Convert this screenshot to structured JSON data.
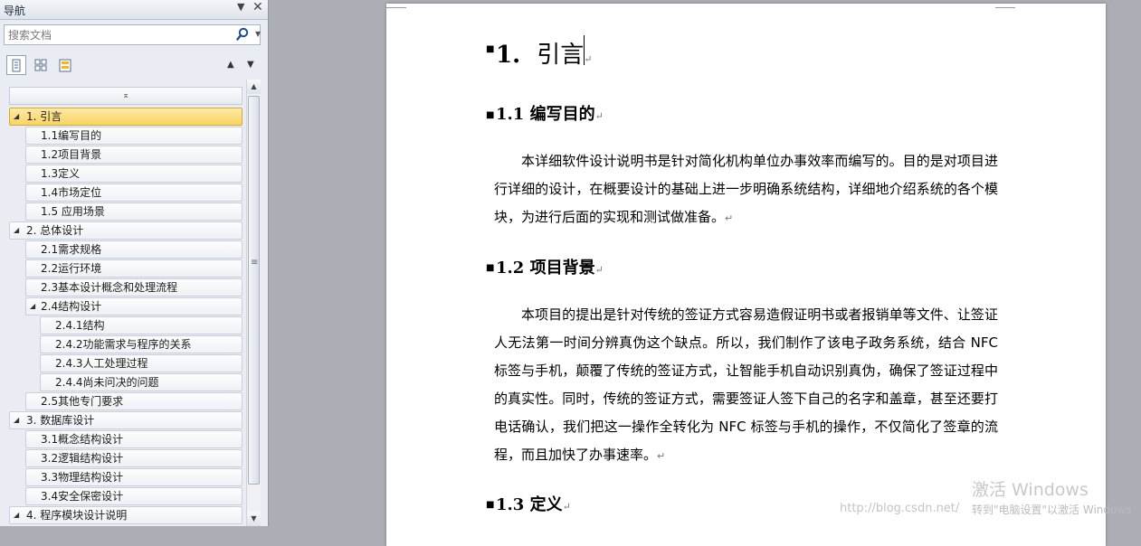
{
  "nav": {
    "title": "导航",
    "pin_glyph": "▼",
    "close_glyph": "✕",
    "search_placeholder": "搜索文档",
    "tabs": [
      "headings",
      "pages",
      "results"
    ],
    "tree": [
      {
        "label": "1. 引言",
        "level": 1,
        "expanded": true,
        "selected": true
      },
      {
        "label": "1.1编写目的",
        "level": 2
      },
      {
        "label": "1.2项目背景",
        "level": 2
      },
      {
        "label": "1.3定义",
        "level": 2
      },
      {
        "label": "1.4市场定位",
        "level": 2
      },
      {
        "label": "1.5 应用场景",
        "level": 2
      },
      {
        "label": "2. 总体设计",
        "level": 1,
        "expanded": true
      },
      {
        "label": "2.1需求规格",
        "level": 2
      },
      {
        "label": "2.2运行环境",
        "level": 2
      },
      {
        "label": "2.3基本设计概念和处理流程",
        "level": 2
      },
      {
        "label": "2.4结构设计",
        "level": 2,
        "expanded": true
      },
      {
        "label": "2.4.1结构",
        "level": 3
      },
      {
        "label": "2.4.2功能需求与程序的关系",
        "level": 3
      },
      {
        "label": "2.4.3人工处理过程",
        "level": 3
      },
      {
        "label": "2.4.4尚未问决的问题",
        "level": 3
      },
      {
        "label": "2.5其他专门要求",
        "level": 2
      },
      {
        "label": "3. 数据库设计",
        "level": 1,
        "expanded": true
      },
      {
        "label": "3.1概念结构设计",
        "level": 2
      },
      {
        "label": "3.2逻辑结构设计",
        "level": 2
      },
      {
        "label": "3.3物理结构设计",
        "level": 2
      },
      {
        "label": "3.4安全保密设计",
        "level": 2
      },
      {
        "label": "4. 程序模块设计说明",
        "level": 1,
        "expanded": true
      }
    ]
  },
  "document": {
    "h1": {
      "num": "1.",
      "text": "引言"
    },
    "sections": [
      {
        "num": "1.1",
        "title": "编写目的"
      },
      {
        "num": "1.2",
        "title": "项目背景"
      },
      {
        "num": "1.3",
        "title": "定义"
      }
    ],
    "para1": "本详细软件设计说明书是针对简化机构单位办事效率而编写的。目的是对项目进行详细的设计，在概要设计的基础上进一步明确系统结构，详细地介绍系统的各个模块，为进行后面的实现和测试做准备。",
    "para2": "本项目的提出是针对传统的签证方式容易造假证明书或者报销单等文件、让签证人无法第一时间分辨真伪这个缺点。所以，我们制作了该电子政务系统，结合 NFC 标签与手机，颠覆了传统的签证方式，让智能手机自动识别真伪，确保了签证过程中的真实性。同时，传统的签证方式，需要签证人签下自己的名字和盖章，甚至还要打电话确认，我们把这一操作全转化为 NFC 标签与手机的操作，不仅简化了签章的流程，而且加快了办事速率。",
    "para_mark": "↵"
  },
  "watermark": {
    "activate_title": "激活 Windows",
    "activate_sub": "转到\"电脑设置\"以激活 Windows",
    "blog_url": "http://blog.csdn.net/"
  }
}
